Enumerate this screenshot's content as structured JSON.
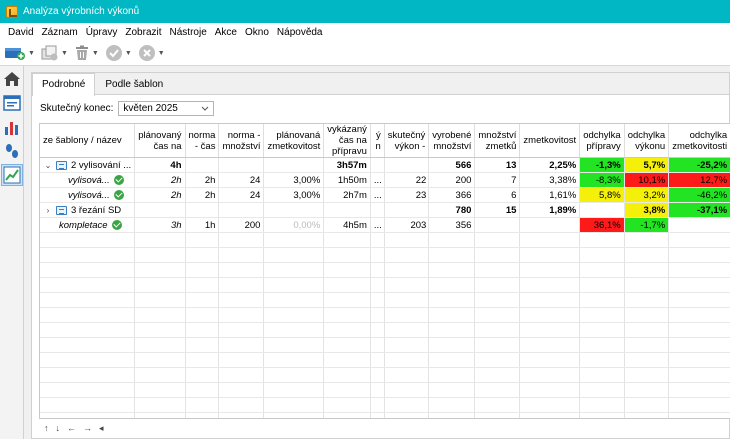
{
  "window": {
    "title": "Analýza výrobních výkonů"
  },
  "menu": [
    "David",
    "Záznam",
    "Úpravy",
    "Zobrazit",
    "Nástroje",
    "Akce",
    "Okno",
    "Nápověda"
  ],
  "tabs": [
    {
      "label": "Podrobné",
      "active": true
    },
    {
      "label": "Podle šablon",
      "active": false
    }
  ],
  "filter": {
    "label": "Skutečný konec:",
    "value": "květen 2025"
  },
  "columns": [
    "ze šablony / název",
    "plánovaný čas na",
    "norma - čas",
    "norma - množství",
    "plánovaná zmetkovitost",
    "vykázaný čas na přípravu",
    "ý n",
    "skutečný výkon -",
    "vyrobené množství",
    "množství zmetků",
    "zmetkovitost",
    "odchylka přípravy",
    "odchylka výkonu",
    "odchylka zmetkovitosti"
  ],
  "rows": [
    {
      "type": "group",
      "expander": "⌄",
      "name": "2 vylisování ...",
      "status": "",
      "cells": [
        "4h",
        "",
        "",
        "",
        "3h57m",
        "",
        "",
        "566",
        "13",
        "2,25%",
        "-1,3%",
        "5,7%",
        "-25,2%"
      ],
      "colors": [
        "",
        "",
        "",
        "",
        "",
        "",
        "",
        "",
        "",
        "",
        "green",
        "yellow",
        "green"
      ]
    },
    {
      "type": "child",
      "name": "vylisová...",
      "status": "ok",
      "cells": [
        "2h",
        "2h",
        "24",
        "3,00%",
        "1h50m",
        "...",
        "22",
        "200",
        "7",
        "3,38%",
        "-8,3%",
        "10,1%",
        "12,7%"
      ],
      "colors": [
        "",
        "",
        "",
        "",
        "",
        "",
        "",
        "",
        "",
        "",
        "green",
        "red",
        "red"
      ]
    },
    {
      "type": "child",
      "name": "vylisová...",
      "status": "ok",
      "cells": [
        "2h",
        "2h",
        "24",
        "3,00%",
        "2h7m",
        "...",
        "23",
        "366",
        "6",
        "1,61%",
        "5,8%",
        "3,2%",
        "-46,2%"
      ],
      "colors": [
        "",
        "",
        "",
        "",
        "",
        "",
        "",
        "",
        "",
        "",
        "yellow",
        "yellow",
        "green"
      ]
    },
    {
      "type": "group",
      "expander": "›",
      "name": "3 řezání SD",
      "status": "",
      "cells": [
        "",
        "",
        "",
        "",
        "",
        "",
        "",
        "780",
        "15",
        "1,89%",
        "",
        "3,8%",
        "-37,1%"
      ],
      "colors": [
        "",
        "",
        "",
        "",
        "",
        "",
        "",
        "",
        "",
        "",
        "",
        "yellow",
        "green"
      ]
    },
    {
      "type": "item",
      "name": "kompletace",
      "status": "ok",
      "cells": [
        "3h",
        "1h",
        "200",
        "0,00%",
        "4h5m",
        "...",
        "203",
        "356",
        "",
        "",
        "36,1%",
        "-1,7%",
        ""
      ],
      "colors": [
        "",
        "",
        "",
        "grey",
        "",
        "",
        "",
        "",
        "",
        "",
        "red",
        "green",
        ""
      ]
    }
  ],
  "empty_rows": 13,
  "bottom_nav": [
    "↑",
    "↓",
    "←",
    "→",
    "◂"
  ],
  "colors": {
    "accent": "#00b7c3",
    "green": "#22e422",
    "yellow": "#f4f00a",
    "red": "#ff1a1a"
  }
}
